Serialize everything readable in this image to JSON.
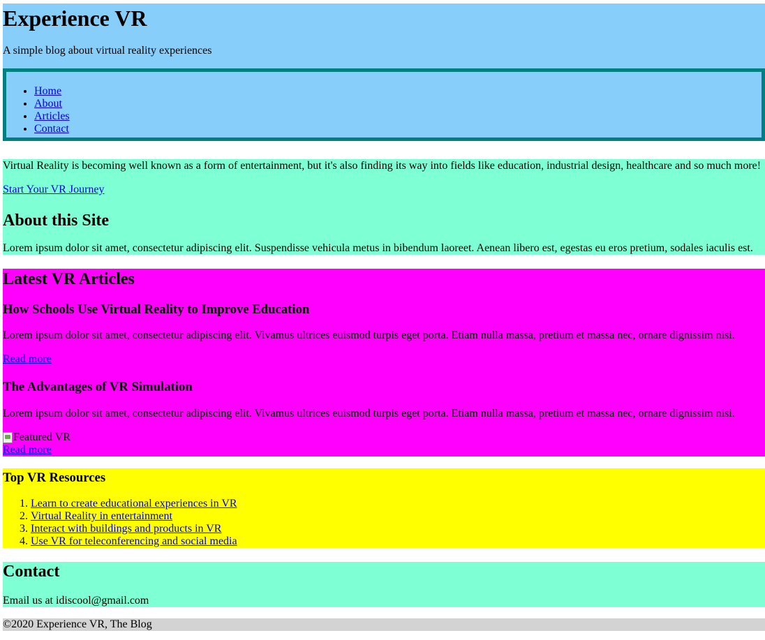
{
  "header": {
    "title": "Experience VR",
    "tagline": "A simple blog about virtual reality experiences"
  },
  "nav": {
    "items": [
      {
        "label": "Home"
      },
      {
        "label": "About"
      },
      {
        "label": "Articles"
      },
      {
        "label": "Contact"
      }
    ]
  },
  "intro": {
    "lead": "Virtual Reality is becoming well known as a form of entertainment, but it's also finding its way into fields like education, industrial design, healthcare and so much more!",
    "cta_label": "Start Your VR Journey",
    "about_heading": "About this Site",
    "about_text": "Lorem ipsum dolor sit amet, consectetur adipiscing elit. Suspendisse vehicula metus in bibendum laoreet. Aenean libero est, egestas eu eros pretium, sodales iaculis est."
  },
  "articles": {
    "heading": "Latest VR Articles",
    "items": [
      {
        "title": "How Schools Use Virtual Reality to Improve Education",
        "text": "Lorem ipsum dolor sit amet, consectetur adipiscing elit. Vivamus ultrices euismod turpis eget porta. Etiam nulla massa, pretium et massa nec, ornare dignissim nisi.",
        "more_label": "Read more"
      },
      {
        "title": "The Advantages of VR Simulation",
        "text": "Lorem ipsum dolor sit amet, consectetur adipiscing elit. Vivamus ultrices euismod turpis eget porta. Etiam nulla massa, pretium et massa nec, ornare dignissim nisi.",
        "image_alt": "Featured VR",
        "more_label": "Read more"
      }
    ]
  },
  "resources": {
    "heading": "Top VR Resources",
    "items": [
      {
        "label": "Learn to create educational experiences in VR"
      },
      {
        "label": "Virtual Reality in entertainment"
      },
      {
        "label": "Interact with buildings and products in VR"
      },
      {
        "label": "Use VR for teleconferencing and social media"
      }
    ]
  },
  "contact": {
    "heading": "Contact",
    "email_text": "Email us at idiscool@gmail.com"
  },
  "footer": {
    "text": "©2020 Experience VR, The Blog"
  },
  "colors": {
    "header_bg": "#87cefa",
    "nav_border": "#008080",
    "intro_bg": "#7fffd4",
    "articles_bg": "#ff00ff",
    "resources_bg": "#ffff00",
    "contact_bg": "#7fffd4",
    "footer_bg": "#d3d3d3",
    "link": "#0000ee"
  }
}
